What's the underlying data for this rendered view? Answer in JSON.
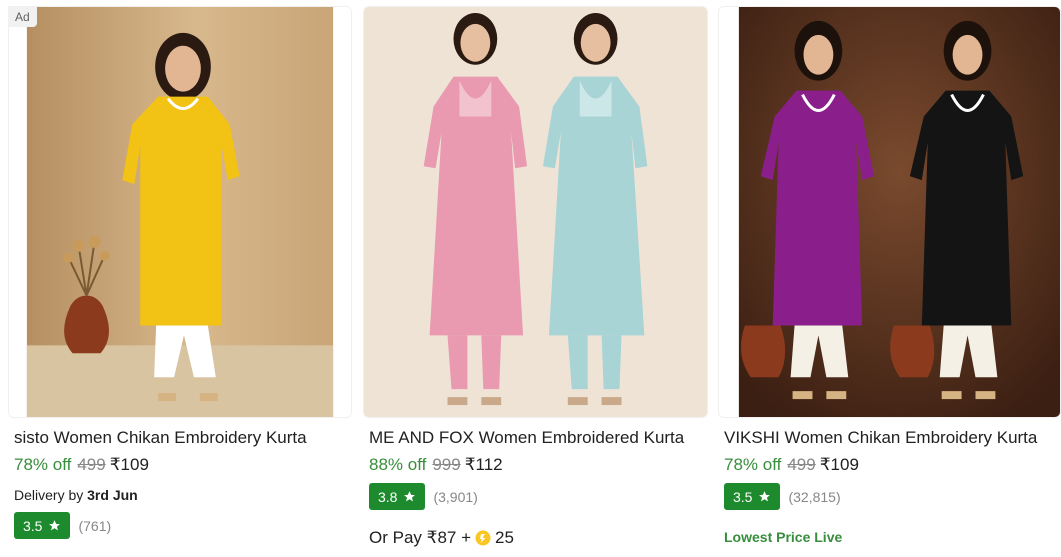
{
  "products": [
    {
      "ad_label": "Ad",
      "title": "sisto Women Chikan Embroidery Kurta",
      "discount": "78% off",
      "mrp": "499",
      "price": "₹109",
      "delivery_prefix": "Delivery by",
      "delivery_date": "3rd Jun",
      "rating": "3.5",
      "rating_count": "(761)",
      "image_icon": "product-image-yellow-kurta"
    },
    {
      "title": "ME AND FOX Women Embroidered Kurta",
      "discount": "88% off",
      "mrp": "999",
      "price": "₹112",
      "rating": "3.8",
      "rating_count": "(3,901)",
      "or_pay_text": "Or Pay ₹87 +",
      "coins": "25",
      "image_icon": "product-image-pink-blue-kurta"
    },
    {
      "title": "VIKSHI Women Chikan Embroidery Kurta",
      "discount": "78% off",
      "mrp": "499",
      "price": "₹109",
      "rating": "3.5",
      "rating_count": "(32,815)",
      "badge_text": "Lowest Price Live",
      "image_icon": "product-image-purple-black-kurta"
    }
  ],
  "colors": {
    "discount_green": "#388e3c",
    "rating_badge_green": "#1e8a2e",
    "mrp_grey": "#878787",
    "coin_gold": "#f9c623"
  }
}
